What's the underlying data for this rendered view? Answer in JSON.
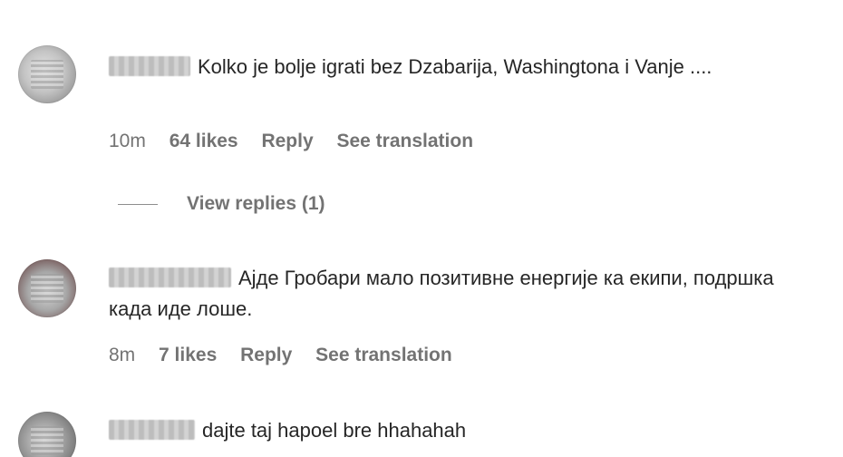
{
  "comments": [
    {
      "username": "__dxk7",
      "text": "Kolko je bolje igrati bez Dzabarija, Washingtona i Vanje ....",
      "time": "10m",
      "likes": "64 likes",
      "reply": "Reply",
      "translation": "See translation"
    },
    {
      "username": "egl090000",
      "text": "Ајде Гробари мало позитивне енергије ка екипи, подршка када иде лоше.",
      "time": "8m",
      "likes": "7 likes",
      "reply": "Reply",
      "translation": "See translation"
    },
    {
      "username": "chrnter",
      "text": "dajte taj hapoel bre hhahahah"
    }
  ],
  "view_replies": "View replies (1)"
}
